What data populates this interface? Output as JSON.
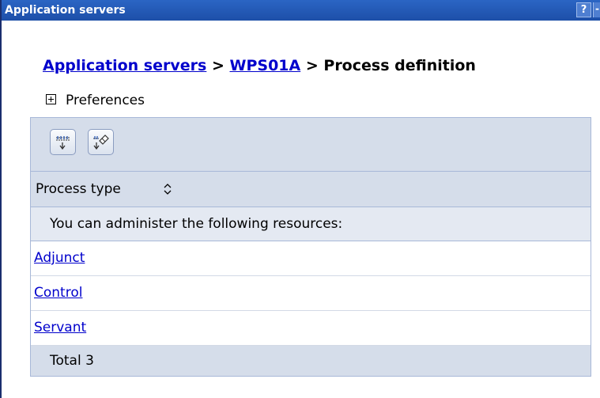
{
  "window": {
    "title": "Application servers",
    "help_label": "?",
    "collapse_label": "-"
  },
  "breadcrumb": {
    "items": [
      {
        "label": "Application servers",
        "link": true
      },
      {
        "label": "WPS01A",
        "link": true
      },
      {
        "label": "Process definition",
        "link": false
      }
    ],
    "separator": ">"
  },
  "preferences": {
    "label": "Preferences",
    "expanded": false
  },
  "table": {
    "toolbar": {
      "buttons": [
        {
          "name": "select-all-icon"
        },
        {
          "name": "deselect-all-icon"
        }
      ]
    },
    "column_header": "Process type",
    "info_text": "You can administer the following resources:",
    "rows": [
      {
        "label": "Adjunct"
      },
      {
        "label": "Control"
      },
      {
        "label": "Servant"
      }
    ],
    "total_text": "Total 3"
  }
}
